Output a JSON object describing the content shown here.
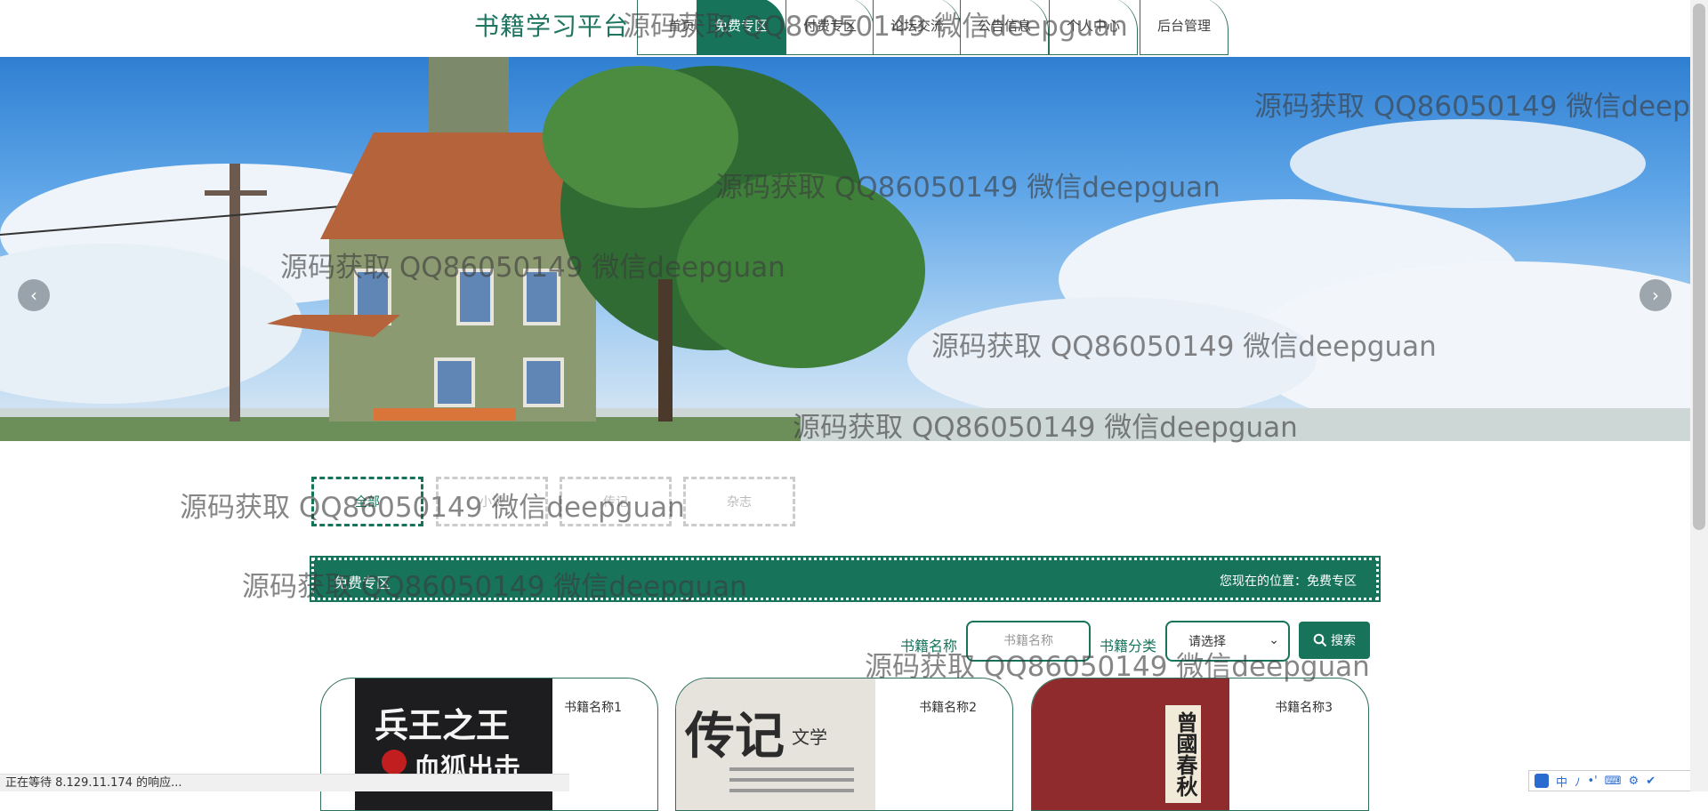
{
  "header": {
    "site_title": "书籍学习平台",
    "nav": [
      {
        "label": "首页",
        "active": false
      },
      {
        "label": "免费专区",
        "active": true
      },
      {
        "label": "付费专区",
        "active": false
      },
      {
        "label": "论坛交流",
        "active": false
      },
      {
        "label": "公告信息",
        "active": false
      },
      {
        "label": "个人中心",
        "active": false
      },
      {
        "label": "后台管理",
        "active": false
      }
    ]
  },
  "banner": {
    "prev_icon": "chevron-left-icon",
    "next_icon": "chevron-right-icon"
  },
  "categories": [
    {
      "label": "全部",
      "active": true
    },
    {
      "label": "小说",
      "active": false
    },
    {
      "label": "传记",
      "active": false
    },
    {
      "label": "杂志",
      "active": false
    }
  ],
  "section": {
    "title": "免费专区",
    "location": "您现在的位置：免费专区"
  },
  "search": {
    "name_label": "书籍名称",
    "name_placeholder": "书籍名称",
    "category_label": "书籍分类",
    "category_selected": "请选择",
    "button_label": "搜索",
    "button_icon": "search-icon"
  },
  "books": [
    {
      "name": "书籍名称1",
      "cover_title": "兵王之王",
      "cover_subtitle": "血狐出击"
    },
    {
      "name": "书籍名称2",
      "cover_title": "传记",
      "cover_subtitle": "文学"
    },
    {
      "name": "书籍名称3",
      "cover_title": "曾國春秋",
      "cover_subtitle": ""
    }
  ],
  "watermark": "源码获取 QQ86050149 微信deepguan",
  "status_text": "正在等待 8.129.11.174 的响应...",
  "tray": {
    "items": [
      "中",
      "ﾉ",
      "•'",
      "⌨",
      "⚙",
      "✔"
    ]
  },
  "colors": {
    "primary": "#17735a",
    "border": "#2f6f5e"
  }
}
